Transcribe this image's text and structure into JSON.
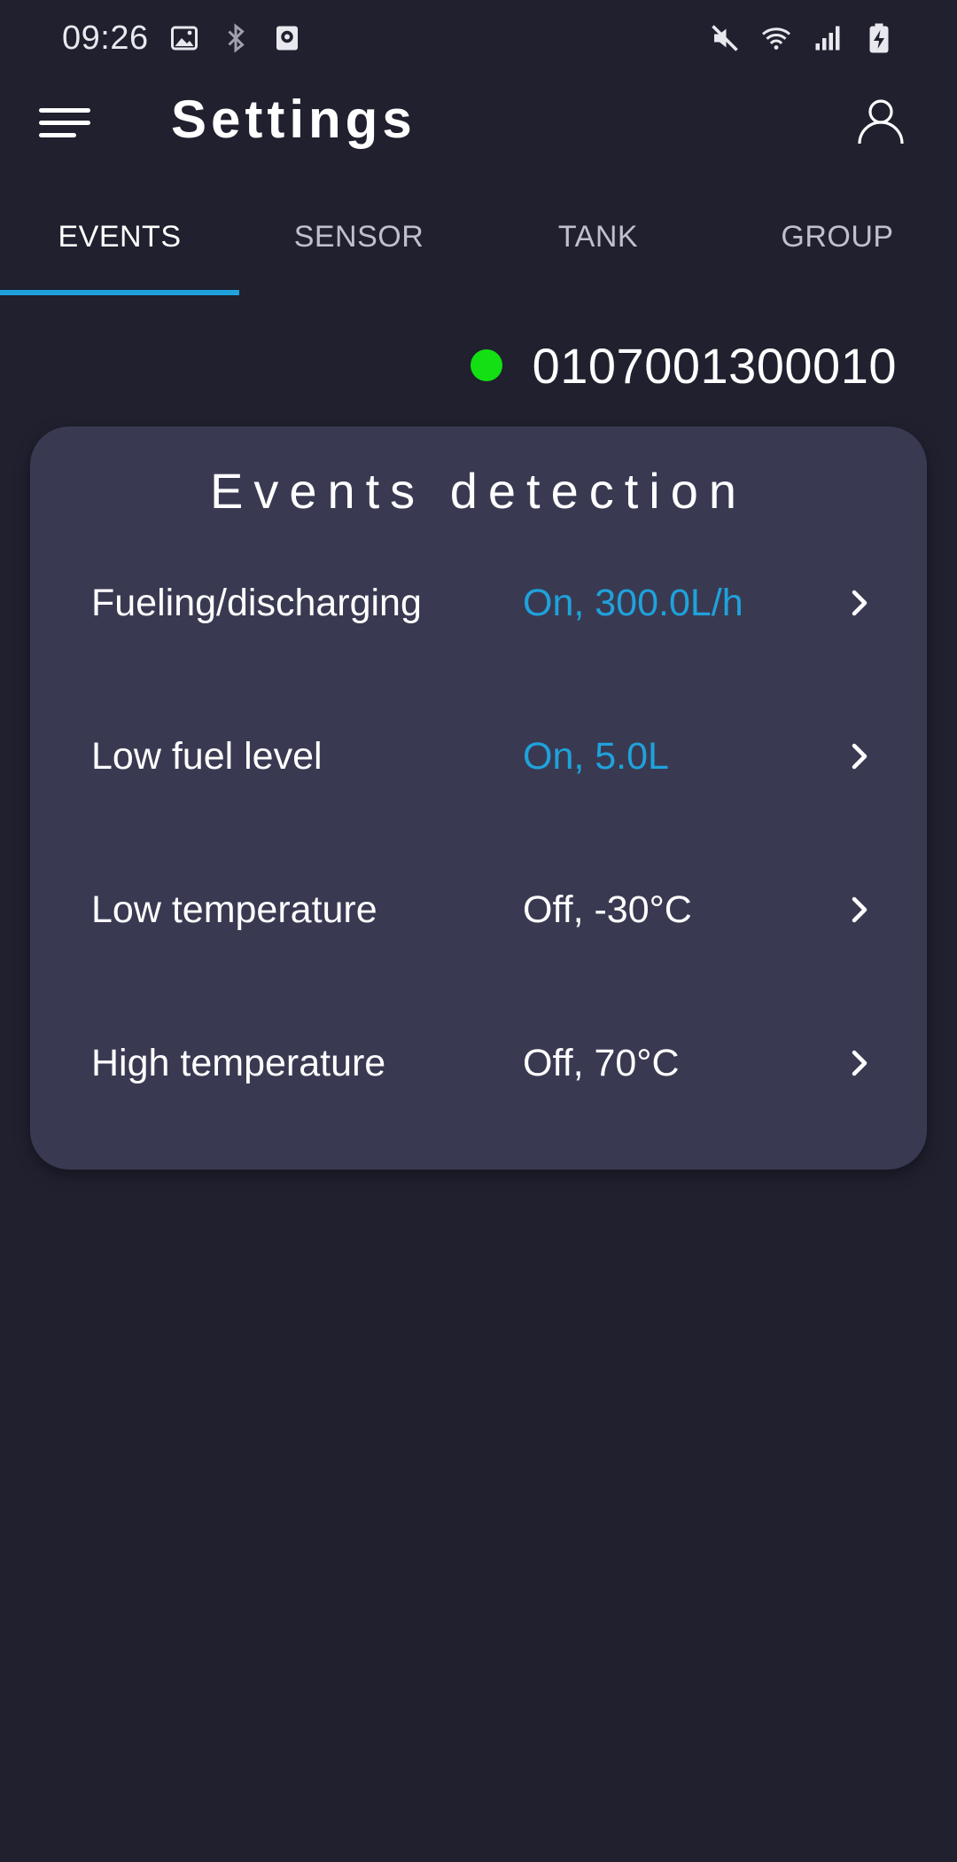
{
  "status_bar": {
    "time": "09:26",
    "left_icons": [
      "image-icon",
      "bluetooth-icon",
      "camera-badge-icon"
    ],
    "right_icons": [
      "mute-icon",
      "wifi-icon",
      "signal-icon",
      "battery-charging-icon"
    ]
  },
  "app_bar": {
    "title": "Settings",
    "menu_icon": "hamburger-menu-icon",
    "profile_icon": "user-profile-icon"
  },
  "tabs": [
    {
      "label": "EVENTS",
      "active": true
    },
    {
      "label": "SENSOR",
      "active": false
    },
    {
      "label": "TANK",
      "active": false
    },
    {
      "label": "GROUP",
      "active": false
    }
  ],
  "device": {
    "id": "0107001300010",
    "status_color": "#12e012"
  },
  "card": {
    "title": "Events detection",
    "rows": [
      {
        "label": "Fueling/discharging",
        "value": "On, 300.0L/h",
        "enabled": true
      },
      {
        "label": "Low fuel level",
        "value": "On, 5.0L",
        "enabled": true
      },
      {
        "label": "Low temperature",
        "value": "Off, -30°C",
        "enabled": false
      },
      {
        "label": "High temperature",
        "value": "Off, 70°C",
        "enabled": false
      }
    ]
  },
  "colors": {
    "background": "#20202f",
    "card": "#393a52",
    "accent": "#1fa2dc",
    "online": "#12e012"
  }
}
